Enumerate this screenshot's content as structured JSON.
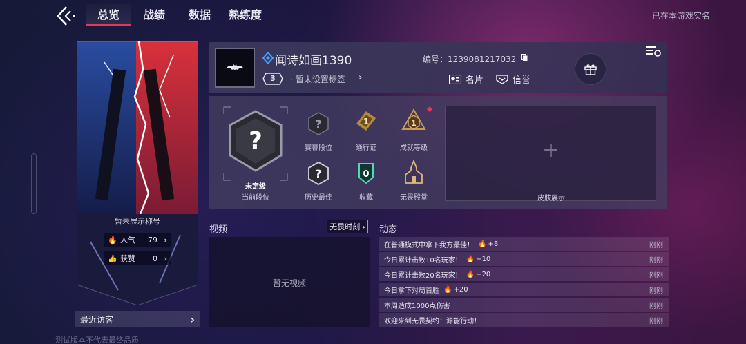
{
  "nav": {
    "tabs": [
      {
        "label": "总览",
        "active": true
      },
      {
        "label": "战绩",
        "active": false
      },
      {
        "label": "数据",
        "active": false
      },
      {
        "label": "熟练度",
        "active": false
      }
    ],
    "realname_notice": "已在本游戏实名",
    "accent": "#e23a55"
  },
  "banner": {
    "title": "暂未展示称号",
    "popularity": {
      "label": "人气",
      "value": "79",
      "icon": "fire-icon"
    },
    "likes": {
      "label": "获赞",
      "value": "0",
      "icon": "thumbs-up-icon"
    }
  },
  "visitor": {
    "label": "最近访客"
  },
  "watermark": "测试版本不代表最终品质",
  "profile": {
    "username": "闻诗如画1390",
    "level": "3",
    "tag": "暂未设置标签",
    "uid_label": "编号：",
    "uid": "1239081217032",
    "namecard": "名片",
    "credit": "信誉"
  },
  "ranks": {
    "current_rank_name": "未定级",
    "current_rank_label": "当前段位",
    "season_rank": "赛幕段位",
    "history_best": "历史最佳",
    "battle_pass": {
      "label": "通行证",
      "value": "1"
    },
    "achievement": {
      "label": "成就等级",
      "value": "1"
    },
    "collection": {
      "label": "收藏",
      "value": "0"
    },
    "hall": {
      "label": "无畏殿堂"
    },
    "skin_label": "皮肤展示"
  },
  "video": {
    "title": "视频",
    "button": "无畏时刻",
    "empty": "暂无视频"
  },
  "feed": {
    "title": "动态",
    "items": [
      {
        "text": "在普通模式中拿下我方最佳！",
        "bonus": "+8",
        "time": "刚刚"
      },
      {
        "text": "今日累计击败10名玩家！",
        "bonus": "+10",
        "time": "刚刚"
      },
      {
        "text": "今日累计击败20名玩家！",
        "bonus": "+20",
        "time": "刚刚"
      },
      {
        "text": "今日拿下对局首胜",
        "bonus": "+20",
        "time": "刚刚"
      },
      {
        "text": "本周造成1000点伤害",
        "bonus": "",
        "time": "刚刚"
      },
      {
        "text": "欢迎来到无畏契约：源能行动！",
        "bonus": "",
        "time": "刚刚"
      }
    ]
  }
}
